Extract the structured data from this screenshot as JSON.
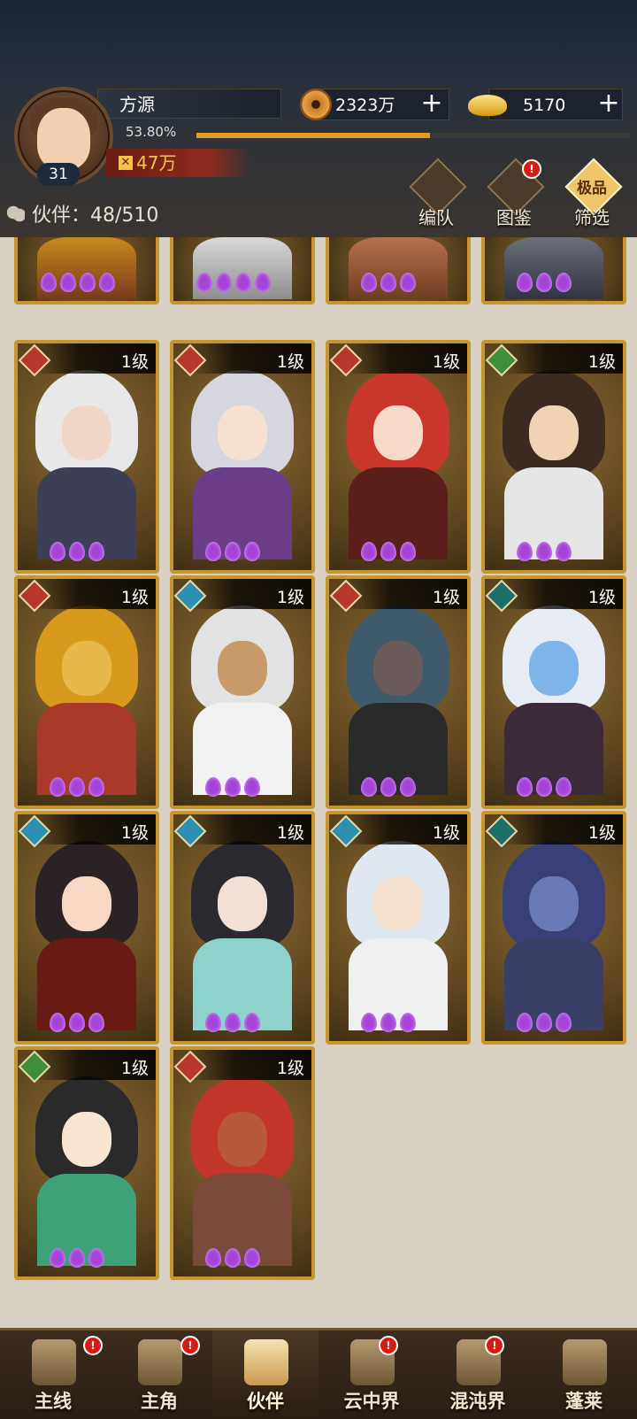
{
  "player": {
    "name": "方源",
    "level": "31",
    "progress_text": "53.80%",
    "progress": 0.538,
    "power": "47万"
  },
  "currency": {
    "coins": "2323万",
    "gold": "5170"
  },
  "partners": {
    "label": "伙伴：",
    "count": "48/510"
  },
  "header_buttons": {
    "team": "编队",
    "catalog": "图鉴",
    "filter": "筛选",
    "filter_badge": "极品"
  },
  "badge_mark": "!",
  "cards": [
    {
      "level": "1级",
      "faction": "fox",
      "faction_color": "#b8372b"
    },
    {
      "level": "1级",
      "faction": "fox",
      "faction_color": "#b8372b"
    },
    {
      "level": "1级",
      "faction": "fox",
      "faction_color": "#b8372b"
    },
    {
      "level": "1级",
      "faction": "leaf",
      "faction_color": "#3f8f3a"
    },
    {
      "level": "1级",
      "faction": "fox",
      "faction_color": "#b8372b"
    },
    {
      "level": "1级",
      "faction": "wave",
      "faction_color": "#2a8fb0"
    },
    {
      "level": "1级",
      "faction": "fox",
      "faction_color": "#b8372b"
    },
    {
      "level": "1级",
      "faction": "demon",
      "faction_color": "#1c6f66"
    },
    {
      "level": "1级",
      "faction": "wave",
      "faction_color": "#2a8fb0"
    },
    {
      "level": "1级",
      "faction": "wave",
      "faction_color": "#2a8fb0"
    },
    {
      "level": "1级",
      "faction": "wave",
      "faction_color": "#2a8fb0"
    },
    {
      "level": "1级",
      "faction": "demon",
      "faction_color": "#1c6f66"
    },
    {
      "level": "1级",
      "faction": "leaf",
      "faction_color": "#3f8f3a"
    },
    {
      "level": "1级",
      "faction": "fox",
      "faction_color": "#b8372b"
    }
  ],
  "nav": {
    "main_line": "主线",
    "protagonist": "主角",
    "partner": "伙伴",
    "cloud_realm": "云中界",
    "chaos_realm": "混沌界",
    "penglai": "蓬莱"
  }
}
